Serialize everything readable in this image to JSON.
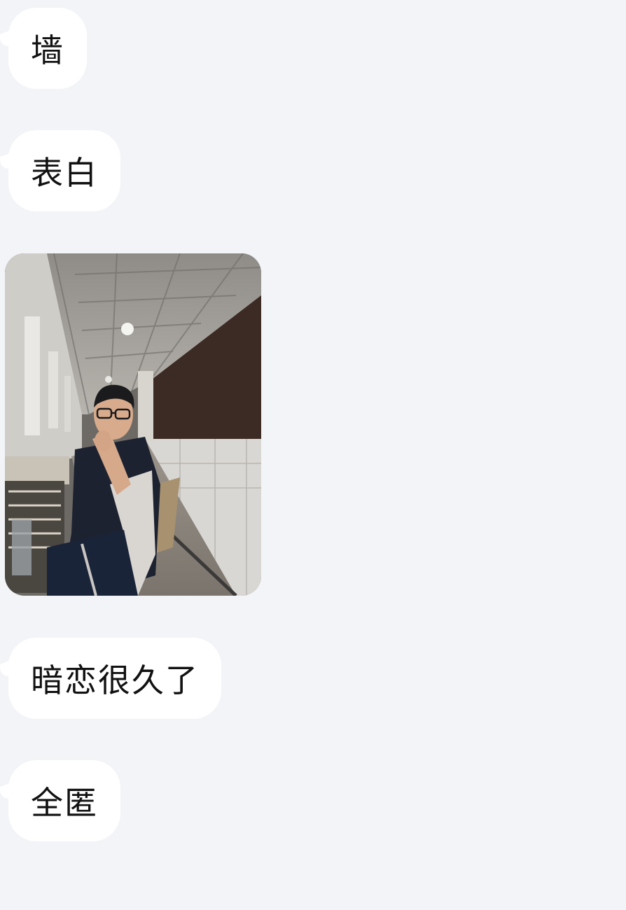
{
  "messages": [
    {
      "type": "text",
      "text": "墙"
    },
    {
      "type": "text",
      "text": "表白"
    },
    {
      "type": "image",
      "icon": "photo"
    },
    {
      "type": "text",
      "text": "暗恋很久了"
    },
    {
      "type": "text",
      "text": "全匿"
    }
  ],
  "colors": {
    "background": "#f3f4f8",
    "bubble": "#ffffff",
    "text": "#111111"
  }
}
